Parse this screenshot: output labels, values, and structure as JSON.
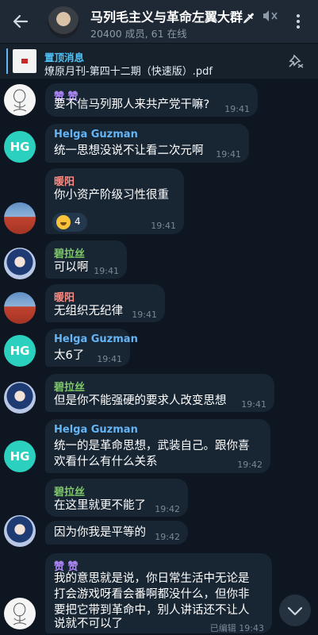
{
  "header": {
    "title": "马列毛主义与革命左翼大群",
    "title_emoji": "🗡",
    "subtitle": "20400 成员, 61 在线"
  },
  "pinned": {
    "title": "置顶消息",
    "text": "燎原月刊-第四十二期（快速版）.pdf"
  },
  "messages": [
    {
      "author": "赞 赞",
      "lines": [
        "要不信马列那人来共产党干嘛?"
      ],
      "time": "19:41"
    },
    {
      "author": "Helga Guzman",
      "avatar_initials": "HG",
      "lines": [
        "统一思想没说不让看二次元啊"
      ],
      "time": "19:41"
    },
    {
      "author": "暖阳",
      "lines": [
        "你小资产阶级习性很重"
      ],
      "time": "19:41",
      "reaction": {
        "emoji": "🤣",
        "count": "4"
      }
    },
    {
      "author": "碧拉丝",
      "lines": [
        "可以啊"
      ],
      "time": "19:41"
    },
    {
      "author": "暖阳",
      "lines": [
        "无组织无纪律"
      ],
      "time": "19:41"
    },
    {
      "author": "Helga Guzman",
      "avatar_initials": "HG",
      "lines": [
        "太6了"
      ],
      "time": "19:41"
    },
    {
      "author": "碧拉丝",
      "lines": [
        "但是你不能强硬的要求人改变思想"
      ],
      "time": "19:41"
    },
    {
      "author": "Helga Guzman",
      "avatar_initials": "HG",
      "lines": [
        "统一的是革命思想，武装自己。跟你喜",
        "欢看什么有什么关系"
      ],
      "time": "19:42"
    },
    {
      "author": "碧拉丝",
      "lines": [
        "在这里就更不能了"
      ],
      "time": "19:42"
    },
    {
      "lines": [
        "因为你我是平等的"
      ],
      "time": "19:42"
    },
    {
      "author": "赞 赞",
      "lines": [
        "我的意思就是说，你日常生活中无论是",
        "打会游戏呀看会番啊都没什么，但你非",
        "要把它带到革命中，别人讲话还不让人",
        "说就不可以了"
      ],
      "time": "19:43",
      "edited": "已编辑"
    }
  ],
  "colors": {
    "background": "#0e1621",
    "header": "#1f2936",
    "bubble": "#182533",
    "accent_link": "#4fc3f7",
    "hg_avatar": "#2bd1be"
  },
  "icons": [
    "back-arrow-icon",
    "mute-icon",
    "more-vertical-icon",
    "unpin-icon",
    "chevron-down-icon"
  ]
}
